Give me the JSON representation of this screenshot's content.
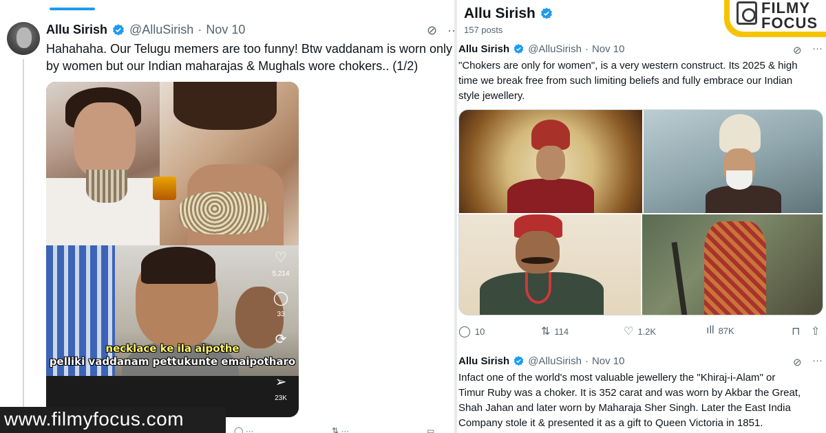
{
  "left_tweet": {
    "author_name": "Allu Sirish",
    "handle": "@AlluSirish",
    "separator": "·",
    "date": "Nov 10",
    "text_line1": "Hahahaha. Our Telugu memers are too funny! Btw vaddanam is worn only",
    "text_line2": "by women but our Indian maharajas & Mughals wore chokers.. (1/2)",
    "meme_caption_line1": "necklace ke ila aipothe",
    "meme_caption_line2": "pelliki vaddanam pettukunte emaipotharo",
    "reel_likes": "5,214",
    "reel_comments": "33",
    "reel_shares": "23K"
  },
  "watermark": "www.filmyfocus.com",
  "right_panel": {
    "profile_name": "Allu Sirish",
    "post_count": "157 posts",
    "logo_line1": "FILMY",
    "logo_line2": "FOCUS"
  },
  "right_tweet_1": {
    "author_name": "Allu Sirish",
    "handle": "@AlluSirish",
    "separator": "·",
    "date": "Nov 10",
    "text_line1": "\"Chokers are only for women\", is a very western construct. Its 2025 & high",
    "text_line2": "time we break free from such limiting beliefs and fully embrace our Indian",
    "text_line3": "style jewellery.",
    "replies": "10",
    "reposts": "114",
    "likes": "1.2K",
    "views": "87K"
  },
  "right_tweet_2": {
    "author_name": "Allu Sirish",
    "handle": "@AlluSirish",
    "separator": "·",
    "date": "Nov 10",
    "text_line1": "Infact one of the world's most valuable jewellery the \"Khiraj-i-Alam\" or",
    "text_line2": "Timur Ruby was a choker. It is 352 carat and was worn by Akbar the Great,",
    "text_line3": "Shah Jahan and later worn by Maharaja Sher Singh. Later the East India",
    "text_line4": "Company stole it & presented it as a gift to Queen Victoria in 1851."
  },
  "colors": {
    "accent": "#1d9bf0",
    "text_primary": "#0f1419",
    "text_secondary": "#536471",
    "logo_yellow": "#f5c400",
    "caption_yellow": "#fff46e"
  },
  "icons": [
    "verified-badge-icon",
    "grok-icon",
    "more-icon",
    "heart-icon",
    "comment-icon",
    "repost-icon",
    "share-icon",
    "reply-icon",
    "views-icon",
    "bookmark-icon",
    "upload-icon"
  ]
}
